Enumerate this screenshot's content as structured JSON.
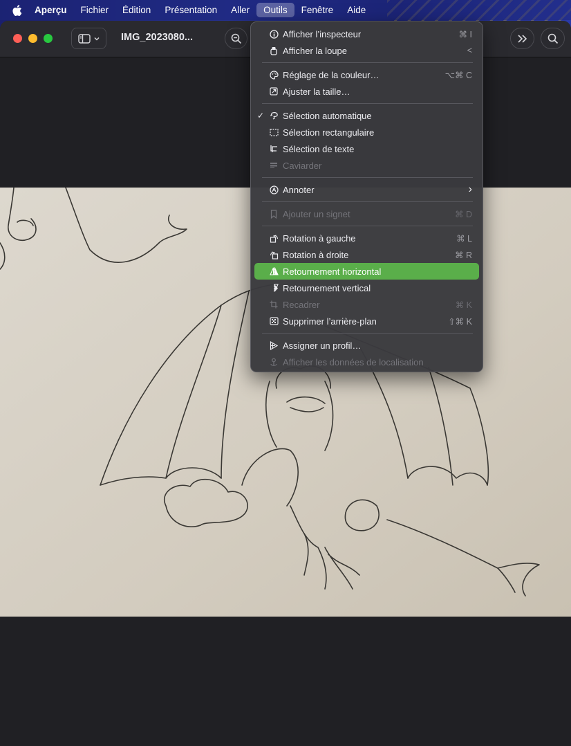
{
  "menubar": {
    "app": "Aperçu",
    "items": [
      "Fichier",
      "Édition",
      "Présentation",
      "Aller",
      "Outils",
      "Fenêtre",
      "Aide"
    ],
    "active": "Outils"
  },
  "window": {
    "title": "IMG_2023080..."
  },
  "tools_menu": {
    "items": [
      {
        "label": "Afficher l’inspecteur",
        "shortcut": "⌘ I",
        "icon": "info-icon"
      },
      {
        "label": "Afficher la loupe",
        "shortcut": "<",
        "icon": "loupe-icon"
      },
      {
        "label": "Réglage de la couleur…",
        "shortcut": "⌥⌘ C",
        "icon": "palette-icon"
      },
      {
        "label": "Ajuster la taille…",
        "shortcut": "",
        "icon": "resize-icon"
      },
      {
        "label": "Sélection automatique",
        "shortcut": "",
        "icon": "lasso-icon",
        "checked": "✓"
      },
      {
        "label": "Sélection rectangulaire",
        "shortcut": "",
        "icon": "rect-select-icon"
      },
      {
        "label": "Sélection de texte",
        "shortcut": "",
        "icon": "text-select-icon"
      },
      {
        "label": "Caviarder",
        "shortcut": "",
        "icon": "redact-icon",
        "disabled": true
      },
      {
        "label": "Annoter",
        "shortcut": "›",
        "icon": "annotate-icon"
      },
      {
        "label": "Ajouter un signet",
        "shortcut": "⌘ D",
        "icon": "bookmark-icon",
        "disabled": true
      },
      {
        "label": "Rotation à gauche",
        "shortcut": "⌘ L",
        "icon": "rotate-left-icon"
      },
      {
        "label": "Rotation à droite",
        "shortcut": "⌘ R",
        "icon": "rotate-right-icon"
      },
      {
        "label": "Retournement horizontal",
        "shortcut": "",
        "icon": "flip-horizontal-icon",
        "highlighted": true
      },
      {
        "label": "Retournement vertical",
        "shortcut": "",
        "icon": "flip-vertical-icon"
      },
      {
        "label": "Recadrer",
        "shortcut": "⌘ K",
        "icon": "crop-icon",
        "disabled": true
      },
      {
        "label": "Supprimer l’arrière-plan",
        "shortcut": "⇧⌘ K",
        "icon": "remove-background-icon"
      },
      {
        "label": "Assigner un profil…",
        "shortcut": "",
        "icon": "profile-icon"
      },
      {
        "label": "Afficher les données de localisation",
        "shortcut": "",
        "icon": "location-icon",
        "disabled": true
      }
    ]
  },
  "colors": {
    "highlight": "#5aae4a",
    "menu_bg": "#3a3a3e",
    "paper": "#d8d2c6"
  }
}
